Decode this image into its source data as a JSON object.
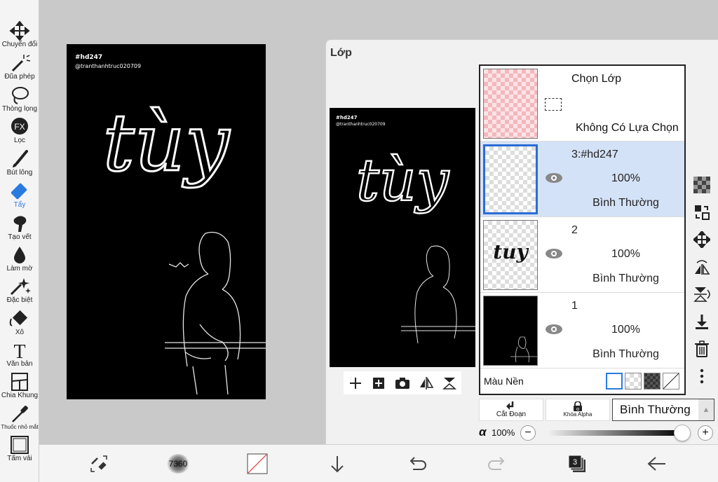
{
  "tools": [
    {
      "label": "Chuyển đổi",
      "icon": "move-icon"
    },
    {
      "label": "Đũa phép",
      "icon": "magic-wand-icon"
    },
    {
      "label": "Thòng lọng",
      "icon": "lasso-icon"
    },
    {
      "label": "Lọc",
      "icon": "fx-filter-icon"
    },
    {
      "label": "Bút lông",
      "icon": "brush-icon"
    },
    {
      "label": "Tẩy",
      "icon": "eraser-icon"
    },
    {
      "label": "Tạo vết",
      "icon": "smudge-icon"
    },
    {
      "label": "Làm mờ",
      "icon": "blur-drop-icon"
    },
    {
      "label": "Đặc biệt",
      "icon": "special-sparkle-icon"
    },
    {
      "label": "Xô",
      "icon": "bucket-icon"
    },
    {
      "label": "Văn bản",
      "icon": "text-icon"
    },
    {
      "label": "Chia Khung",
      "icon": "frame-divider-icon"
    },
    {
      "label": "Thuốc nhỏ mắt",
      "icon": "eyedropper-icon"
    },
    {
      "label": "Tấm vải",
      "icon": "canvas-icon"
    }
  ],
  "active_tool": "Tẩy",
  "fx_label": "FX",
  "artwork": {
    "tag": "#hd247",
    "credit": "@tranthanhtruc020709",
    "title": "tùy",
    "thumb_word": "tuy"
  },
  "layer_panel": {
    "title": "Lớp",
    "selection_row": {
      "name": "Chọn Lớp",
      "status": "Không Có Lựa Chọn"
    },
    "layers": [
      {
        "name": "3:#hd247",
        "opacity": "100%",
        "blend": "Bình Thường",
        "selected": true
      },
      {
        "name": "2",
        "opacity": "100%",
        "blend": "Bình Thường",
        "selected": false
      },
      {
        "name": "1",
        "opacity": "100%",
        "blend": "Bình Thường",
        "selected": false
      }
    ],
    "background_label": "Màu Nền",
    "clip_label": "Cắt Đoạn",
    "alpha_lock_label": "Khóa Alpha",
    "blend_mode": "Bình Thường",
    "alpha_symbol": "α",
    "alpha_value": "100%",
    "alpha_level": 1.0,
    "minus": "−",
    "plus": "+"
  },
  "bottombar": {
    "brush_size": "7360",
    "layer_count": "3"
  },
  "colors": {
    "accent": "#2a7be0",
    "selected_layer": "#d4e2f7",
    "canvas_bg": "#000000"
  }
}
